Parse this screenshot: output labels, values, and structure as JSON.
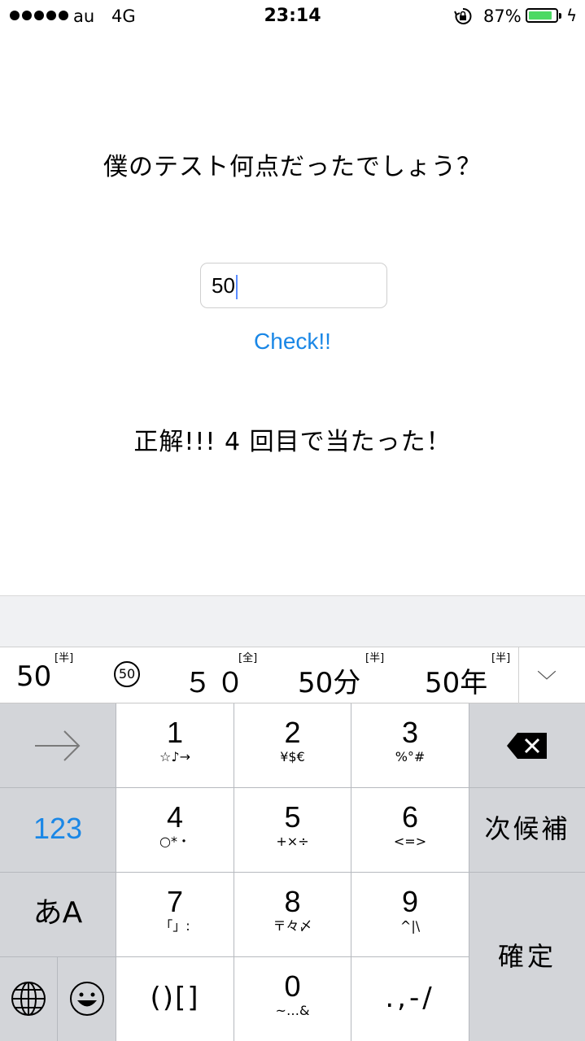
{
  "status_bar": {
    "carrier": "au",
    "network": "4G",
    "time": "23:14",
    "battery_percent": "87%",
    "battery_level": 0.87,
    "battery_color": "#4cd964",
    "icons": [
      "signal-dots-icon",
      "rotation-lock-icon",
      "battery-icon",
      "charging-bolt-icon"
    ]
  },
  "main": {
    "question": "僕のテスト何点だったでしょう？",
    "input_value": "50",
    "check_label": "Check!!",
    "result": "正解!!! 4 回目で当たった！",
    "accent_color": "#1a87e6"
  },
  "keyboard": {
    "candidates": [
      {
        "text": "50",
        "tag": "[半]"
      },
      {
        "text": "㊿",
        "tag": ""
      },
      {
        "text": "５０",
        "tag": "[全]"
      },
      {
        "text": "50分",
        "tag": "[半]"
      },
      {
        "text": "50年",
        "tag": "[半]"
      }
    ],
    "expand_icon": "chevron-down-icon",
    "keys": {
      "k1": {
        "main": "1",
        "sub": "☆♪→"
      },
      "k2": {
        "main": "2",
        "sub": "¥$€"
      },
      "k3": {
        "main": "3",
        "sub": "%°#"
      },
      "k4": {
        "main": "4",
        "sub": "○*・"
      },
      "k5": {
        "main": "5",
        "sub": "+×÷"
      },
      "k6": {
        "main": "6",
        "sub": "<=>"
      },
      "k7": {
        "main": "7",
        "sub": "「」:"
      },
      "k8": {
        "main": "8",
        "sub": "〒々〆"
      },
      "k9": {
        "main": "9",
        "sub": "^|\\"
      },
      "k0": {
        "main": "0",
        "sub": "~…&"
      },
      "paren": "()[]",
      "punct": ".,-/",
      "mode_123": "123",
      "kana_mode": "あA",
      "next_candidate": "次候補",
      "confirm": "確定"
    }
  }
}
